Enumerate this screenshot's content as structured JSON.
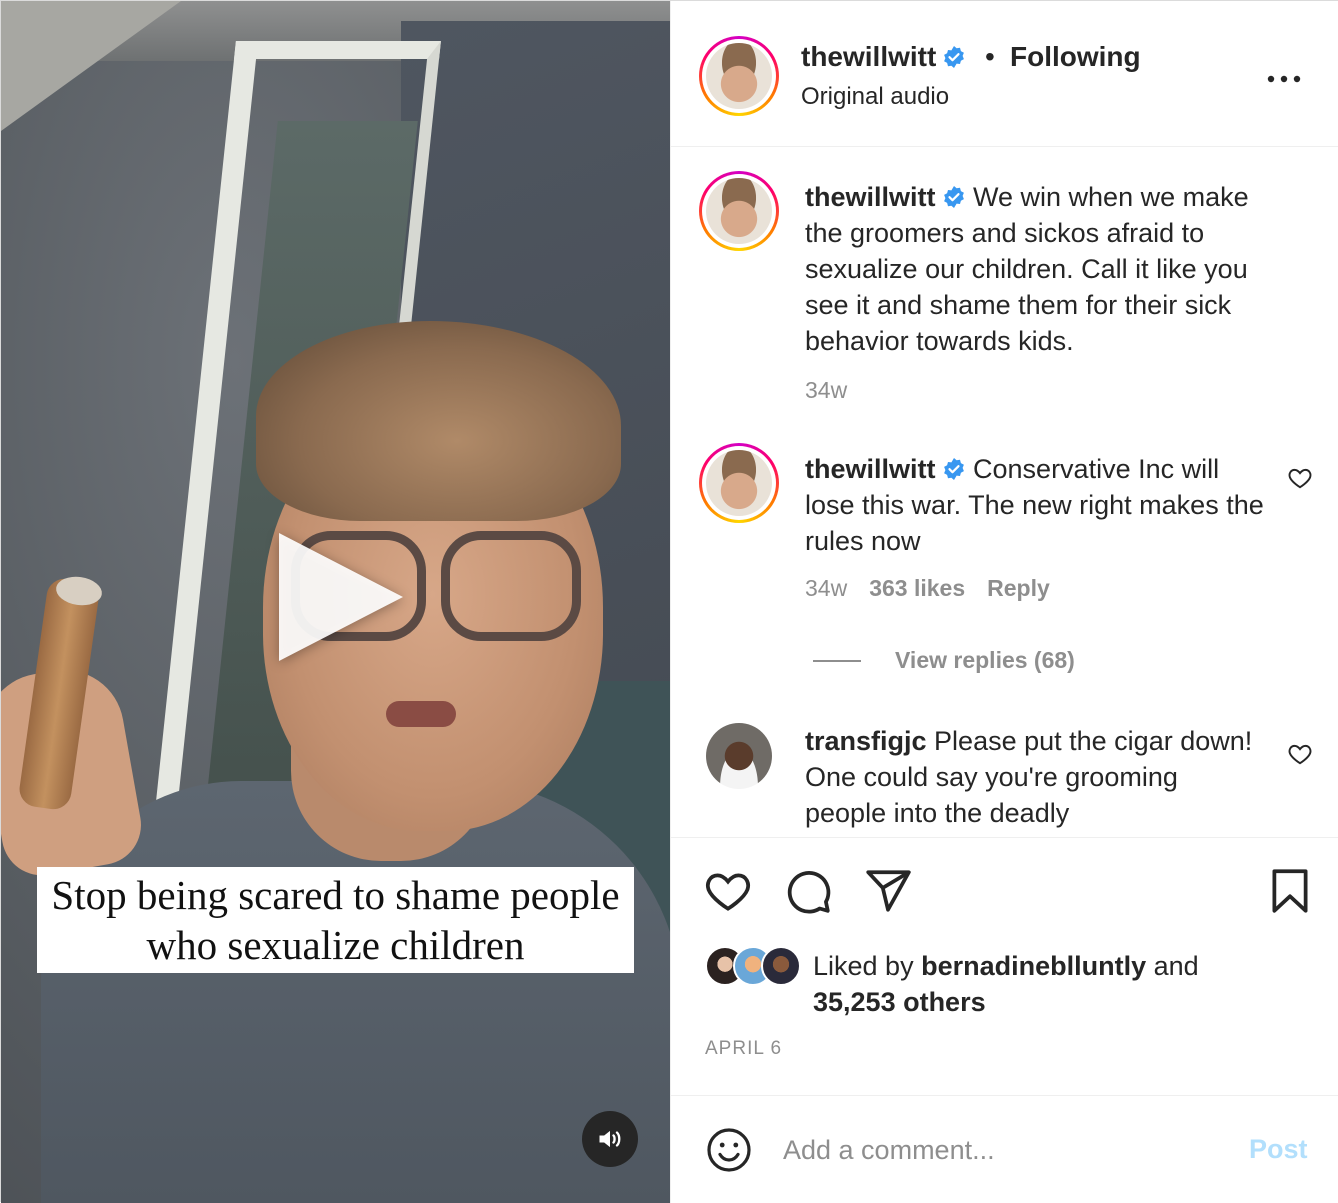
{
  "post": {
    "username": "thewillwitt",
    "separator": "•",
    "follow_status": "Following",
    "audio": "Original audio",
    "more_icon": "more-horizontal-icon"
  },
  "video": {
    "caption_overlay": "Stop being scared to shame people who sexualize children",
    "play_icon": "play-icon",
    "mute_icon": "speaker-icon"
  },
  "comments": [
    {
      "username": "thewillwitt",
      "text": "We win when we make the groomers and sickos afraid to sexualize our children. Call it like you see it and shame them for their sick behavior towards kids.",
      "age": "34w"
    },
    {
      "username": "thewillwitt",
      "text": "Conservative Inc will lose this war. The new right makes the rules now",
      "age": "34w",
      "likes": "363 likes",
      "reply_label": "Reply",
      "view_replies": "View replies (68)"
    },
    {
      "username": "transfigjc",
      "text": "Please put the cigar down! One could say you're grooming people into the deadly"
    }
  ],
  "actions": {
    "like_icon": "heart-icon",
    "comment_icon": "comment-icon",
    "share_icon": "send-icon",
    "save_icon": "bookmark-icon"
  },
  "likes": {
    "prefix": "Liked by",
    "top_liker": "bernadineblluntly",
    "and": "and",
    "others": "35,253 others"
  },
  "date": "APRIL 6",
  "add_comment": {
    "placeholder": "Add a comment...",
    "post_label": "Post"
  },
  "colors": {
    "verified_blue": "#3897f0",
    "post_disabled": "#b2dffc",
    "secondary_text": "#8e8e8e"
  }
}
